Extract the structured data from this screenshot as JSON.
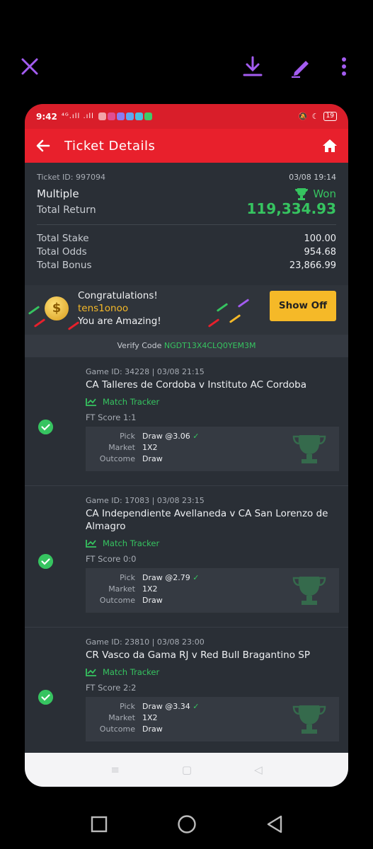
{
  "viewer": {
    "accent": "#a35cf0",
    "icons": [
      "close-icon",
      "download-icon",
      "edit-icon",
      "more-icon"
    ]
  },
  "status_bar": {
    "time": "9:42",
    "signal": "⁴ᴳ.ıll .ıll",
    "battery": "19"
  },
  "header": {
    "title": "Ticket Details",
    "bg_color": "#e8202c"
  },
  "ticket": {
    "id": "Ticket ID: 997094",
    "date": "03/08 19:14",
    "type": "Multiple",
    "status": "Won",
    "total_return_label": "Total Return",
    "total_return": "119,334.93",
    "total_stake_label": "Total Stake",
    "total_stake": "100.00",
    "total_odds_label": "Total Odds",
    "total_odds": "954.68",
    "total_bonus_label": "Total Bonus",
    "total_bonus": "23,866.99"
  },
  "congrats": {
    "line1": "Congratulations!",
    "user": "tens1onoo",
    "line3": "You are Amazing!",
    "show_off": "Show Off"
  },
  "verify": {
    "label": "Verify Code",
    "code": "NGDT13X4CLQ0YEM3M"
  },
  "labels": {
    "match_tracker": "Match Tracker",
    "pick": "Pick",
    "market": "Market",
    "outcome": "Outcome"
  },
  "matches": [
    {
      "game_id": "Game ID: 34228 | 03/08 21:15",
      "teams": "CA Talleres de Cordoba v Instituto AC Cordoba",
      "ft_score": "FT Score  1:1",
      "pick": "Draw @3.06",
      "market": "1X2",
      "outcome": "Draw"
    },
    {
      "game_id": "Game ID: 17083 | 03/08 23:15",
      "teams": "CA Independiente Avellaneda v CA San Lorenzo de Almagro",
      "ft_score": "FT Score  0:0",
      "pick": "Draw @2.79",
      "market": "1X2",
      "outcome": "Draw"
    },
    {
      "game_id": "Game ID: 23810 | 03/08 23:00",
      "teams": "CR Vasco da Gama RJ v Red Bull Bragantino SP",
      "ft_score": "FT Score  2:2",
      "pick": "Draw @3.34",
      "market": "1X2",
      "outcome": "Draw"
    }
  ],
  "nav": {
    "menu": "≡",
    "home": "▢",
    "back": "◁"
  }
}
